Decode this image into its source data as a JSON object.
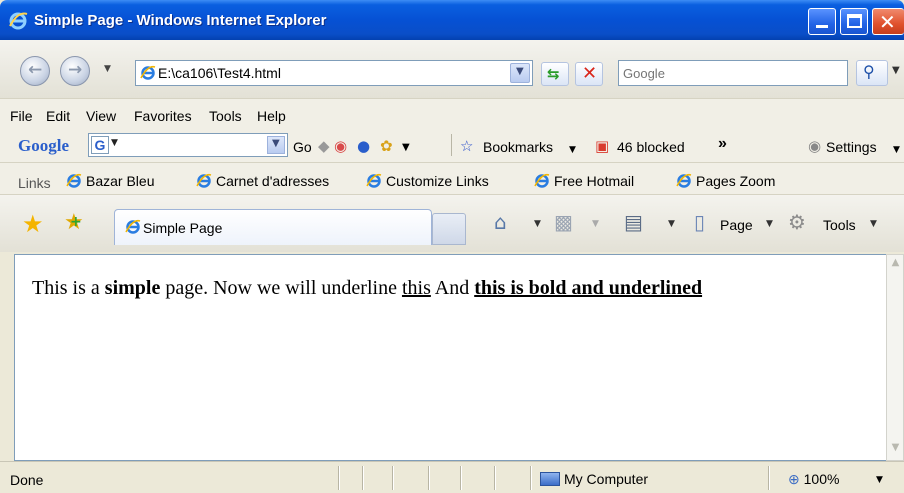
{
  "window": {
    "title": "Simple Page - Windows Internet Explorer"
  },
  "address": {
    "url": "E:\\ca106\\Test4.html"
  },
  "search": {
    "placeholder": "Google"
  },
  "menu": {
    "items": [
      "File",
      "Edit",
      "View",
      "Favorites",
      "Tools",
      "Help"
    ]
  },
  "google_toolbar": {
    "logo": "Google",
    "go_label": "Go",
    "bookmarks_label": "Bookmarks",
    "blocked_label": "46 blocked",
    "more_label": "»",
    "settings_label": "Settings"
  },
  "links": {
    "label": "Links",
    "items": [
      "Bazar Bleu",
      "Carnet d'adresses",
      "Customize Links",
      "Free Hotmail",
      "Pages Zoom"
    ]
  },
  "tabs": {
    "active_label": "Simple Page"
  },
  "command_bar": {
    "page_label": "Page",
    "tools_label": "Tools"
  },
  "content": {
    "part1": "This is a ",
    "bold1": "simple",
    "part2": " page. Now we will underline ",
    "underline1": "this",
    "part3": " And ",
    "bold_underline": "this is bold and underlined"
  },
  "status": {
    "text": "Done",
    "zone": "My Computer",
    "zoom": "100%"
  },
  "colors": {
    "titlebar": "#0651d4",
    "close_button": "#e0512d",
    "chrome": "#ece9d8"
  }
}
